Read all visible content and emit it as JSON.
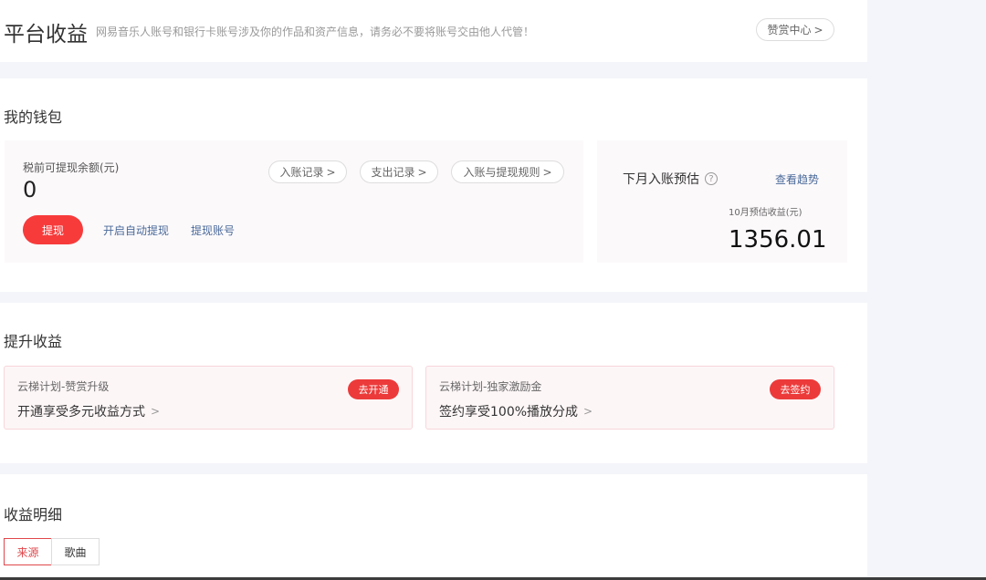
{
  "header": {
    "title": "平台收益",
    "subtitle": "网易音乐人账号和银行卡账号涉及你的作品和资产信息，请务必不要将账号交由他人代管！",
    "reward_center_label": "赞赏中心",
    "chevron": ">"
  },
  "wallet": {
    "title": "我的钱包",
    "balance_label": "税前可提现余额(元)",
    "balance_value": "0",
    "records": [
      {
        "label": "入账记录",
        "chevron": ">"
      },
      {
        "label": "支出记录",
        "chevron": ">"
      },
      {
        "label": "入账与提现规则",
        "chevron": ">"
      }
    ],
    "withdraw_label": "提现",
    "auto_withdraw_label": "开启自动提现",
    "withdraw_account_label": "提现账号",
    "estimate": {
      "title": "下月入账预估",
      "help_icon": "?",
      "trend_label": "查看趋势",
      "month_label": "10月预估收益(元)",
      "value": "1356.01"
    }
  },
  "boost": {
    "title": "提升收益",
    "cards": [
      {
        "label": "云梯计划-赞赏升级",
        "text": "开通享受多元收益方式",
        "button": "去开通",
        "chevron": ">"
      },
      {
        "label": "云梯计划-独家激励金",
        "text": "签约享受100%播放分成",
        "button": "去签约",
        "chevron": ">"
      }
    ]
  },
  "details": {
    "title": "收益明细",
    "tabs": [
      {
        "label": "来源",
        "active": true
      },
      {
        "label": "歌曲",
        "active": false
      }
    ]
  },
  "colors": {
    "accent_red": "#f73b3b",
    "link_blue": "#4a6a99",
    "background": "#f4f5fa"
  }
}
